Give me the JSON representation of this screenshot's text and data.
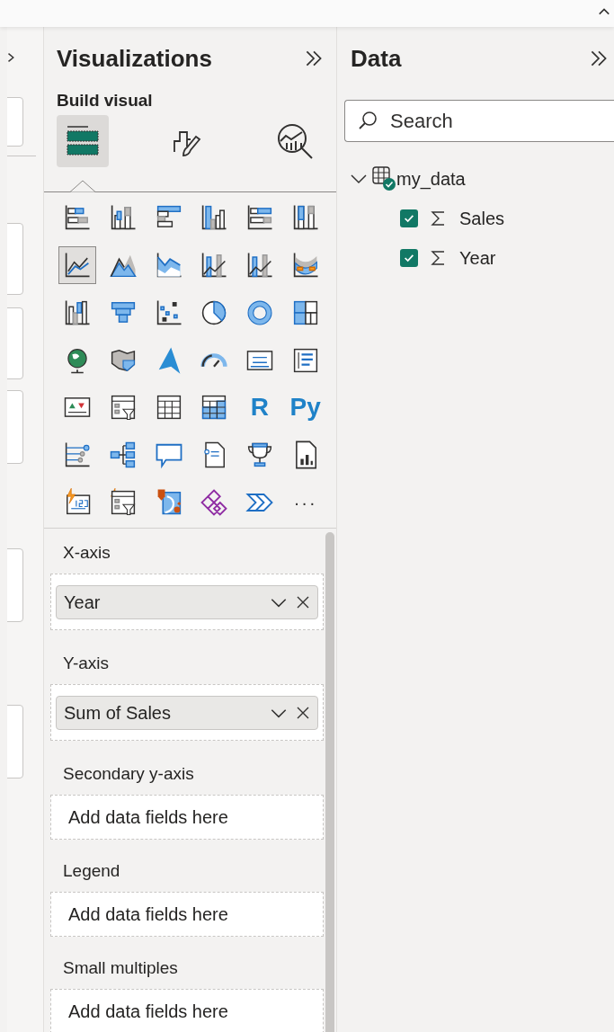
{
  "visualizations": {
    "title": "Visualizations",
    "subtitle": "Build visual",
    "tabs": [
      {
        "kind": "build",
        "selected": true
      },
      {
        "kind": "format",
        "selected": false
      },
      {
        "kind": "analytics",
        "selected": false
      }
    ],
    "visuals": [
      {
        "kind": "stacked-bar",
        "selected": false
      },
      {
        "kind": "stacked-column",
        "selected": false
      },
      {
        "kind": "clustered-bar",
        "selected": false
      },
      {
        "kind": "clustered-column",
        "selected": false
      },
      {
        "kind": "bar-100",
        "selected": false
      },
      {
        "kind": "column-100",
        "selected": false
      },
      {
        "kind": "line",
        "selected": true
      },
      {
        "kind": "area",
        "selected": false
      },
      {
        "kind": "stacked-area",
        "selected": false
      },
      {
        "kind": "line-column",
        "selected": false
      },
      {
        "kind": "line-column-2",
        "selected": false
      },
      {
        "kind": "ribbon",
        "selected": false
      },
      {
        "kind": "waterfall",
        "selected": false
      },
      {
        "kind": "funnel",
        "selected": false
      },
      {
        "kind": "scatter",
        "selected": false
      },
      {
        "kind": "pie",
        "selected": false
      },
      {
        "kind": "donut",
        "selected": false
      },
      {
        "kind": "treemap",
        "selected": false
      },
      {
        "kind": "globe",
        "selected": false
      },
      {
        "kind": "filled-map",
        "selected": false
      },
      {
        "kind": "arrow",
        "selected": false
      },
      {
        "kind": "gauge",
        "selected": false
      },
      {
        "kind": "card",
        "selected": false
      },
      {
        "kind": "multi-card",
        "selected": false
      },
      {
        "kind": "kpi",
        "selected": false
      },
      {
        "kind": "slicer",
        "selected": false
      },
      {
        "kind": "table",
        "selected": false
      },
      {
        "kind": "matrix",
        "selected": false
      },
      {
        "kind": "script",
        "label": "R",
        "selected": false
      },
      {
        "kind": "script",
        "label": "Py",
        "selected": false
      },
      {
        "kind": "influencers",
        "selected": false
      },
      {
        "kind": "decomposition",
        "selected": false
      },
      {
        "kind": "speech",
        "selected": false
      },
      {
        "kind": "narrative",
        "selected": false
      },
      {
        "kind": "trophy",
        "selected": false
      },
      {
        "kind": "report",
        "selected": false
      },
      {
        "kind": "card-new",
        "selected": false
      },
      {
        "kind": "slicer-new",
        "selected": false
      },
      {
        "kind": "pin-map",
        "selected": false
      },
      {
        "kind": "apps",
        "selected": false
      },
      {
        "kind": "automate",
        "selected": false
      },
      {
        "kind": "more",
        "label": "···",
        "selected": false
      }
    ],
    "wells": [
      {
        "label": "X-axis",
        "fields": [
          "Year"
        ]
      },
      {
        "label": "Y-axis",
        "fields": [
          "Sum of Sales"
        ]
      },
      {
        "label": "Secondary y-axis",
        "placeholder": "Add data fields here"
      },
      {
        "label": "Legend",
        "placeholder": "Add data fields here"
      },
      {
        "label": "Small multiples",
        "placeholder": "Add data fields here"
      }
    ]
  },
  "data": {
    "title": "Data",
    "search": {
      "placeholder": "Search"
    },
    "tables": [
      {
        "name": "my_data",
        "expanded": true,
        "children": [
          {
            "name": "Sales",
            "checked": true
          },
          {
            "name": "Year",
            "checked": true
          }
        ]
      }
    ]
  }
}
